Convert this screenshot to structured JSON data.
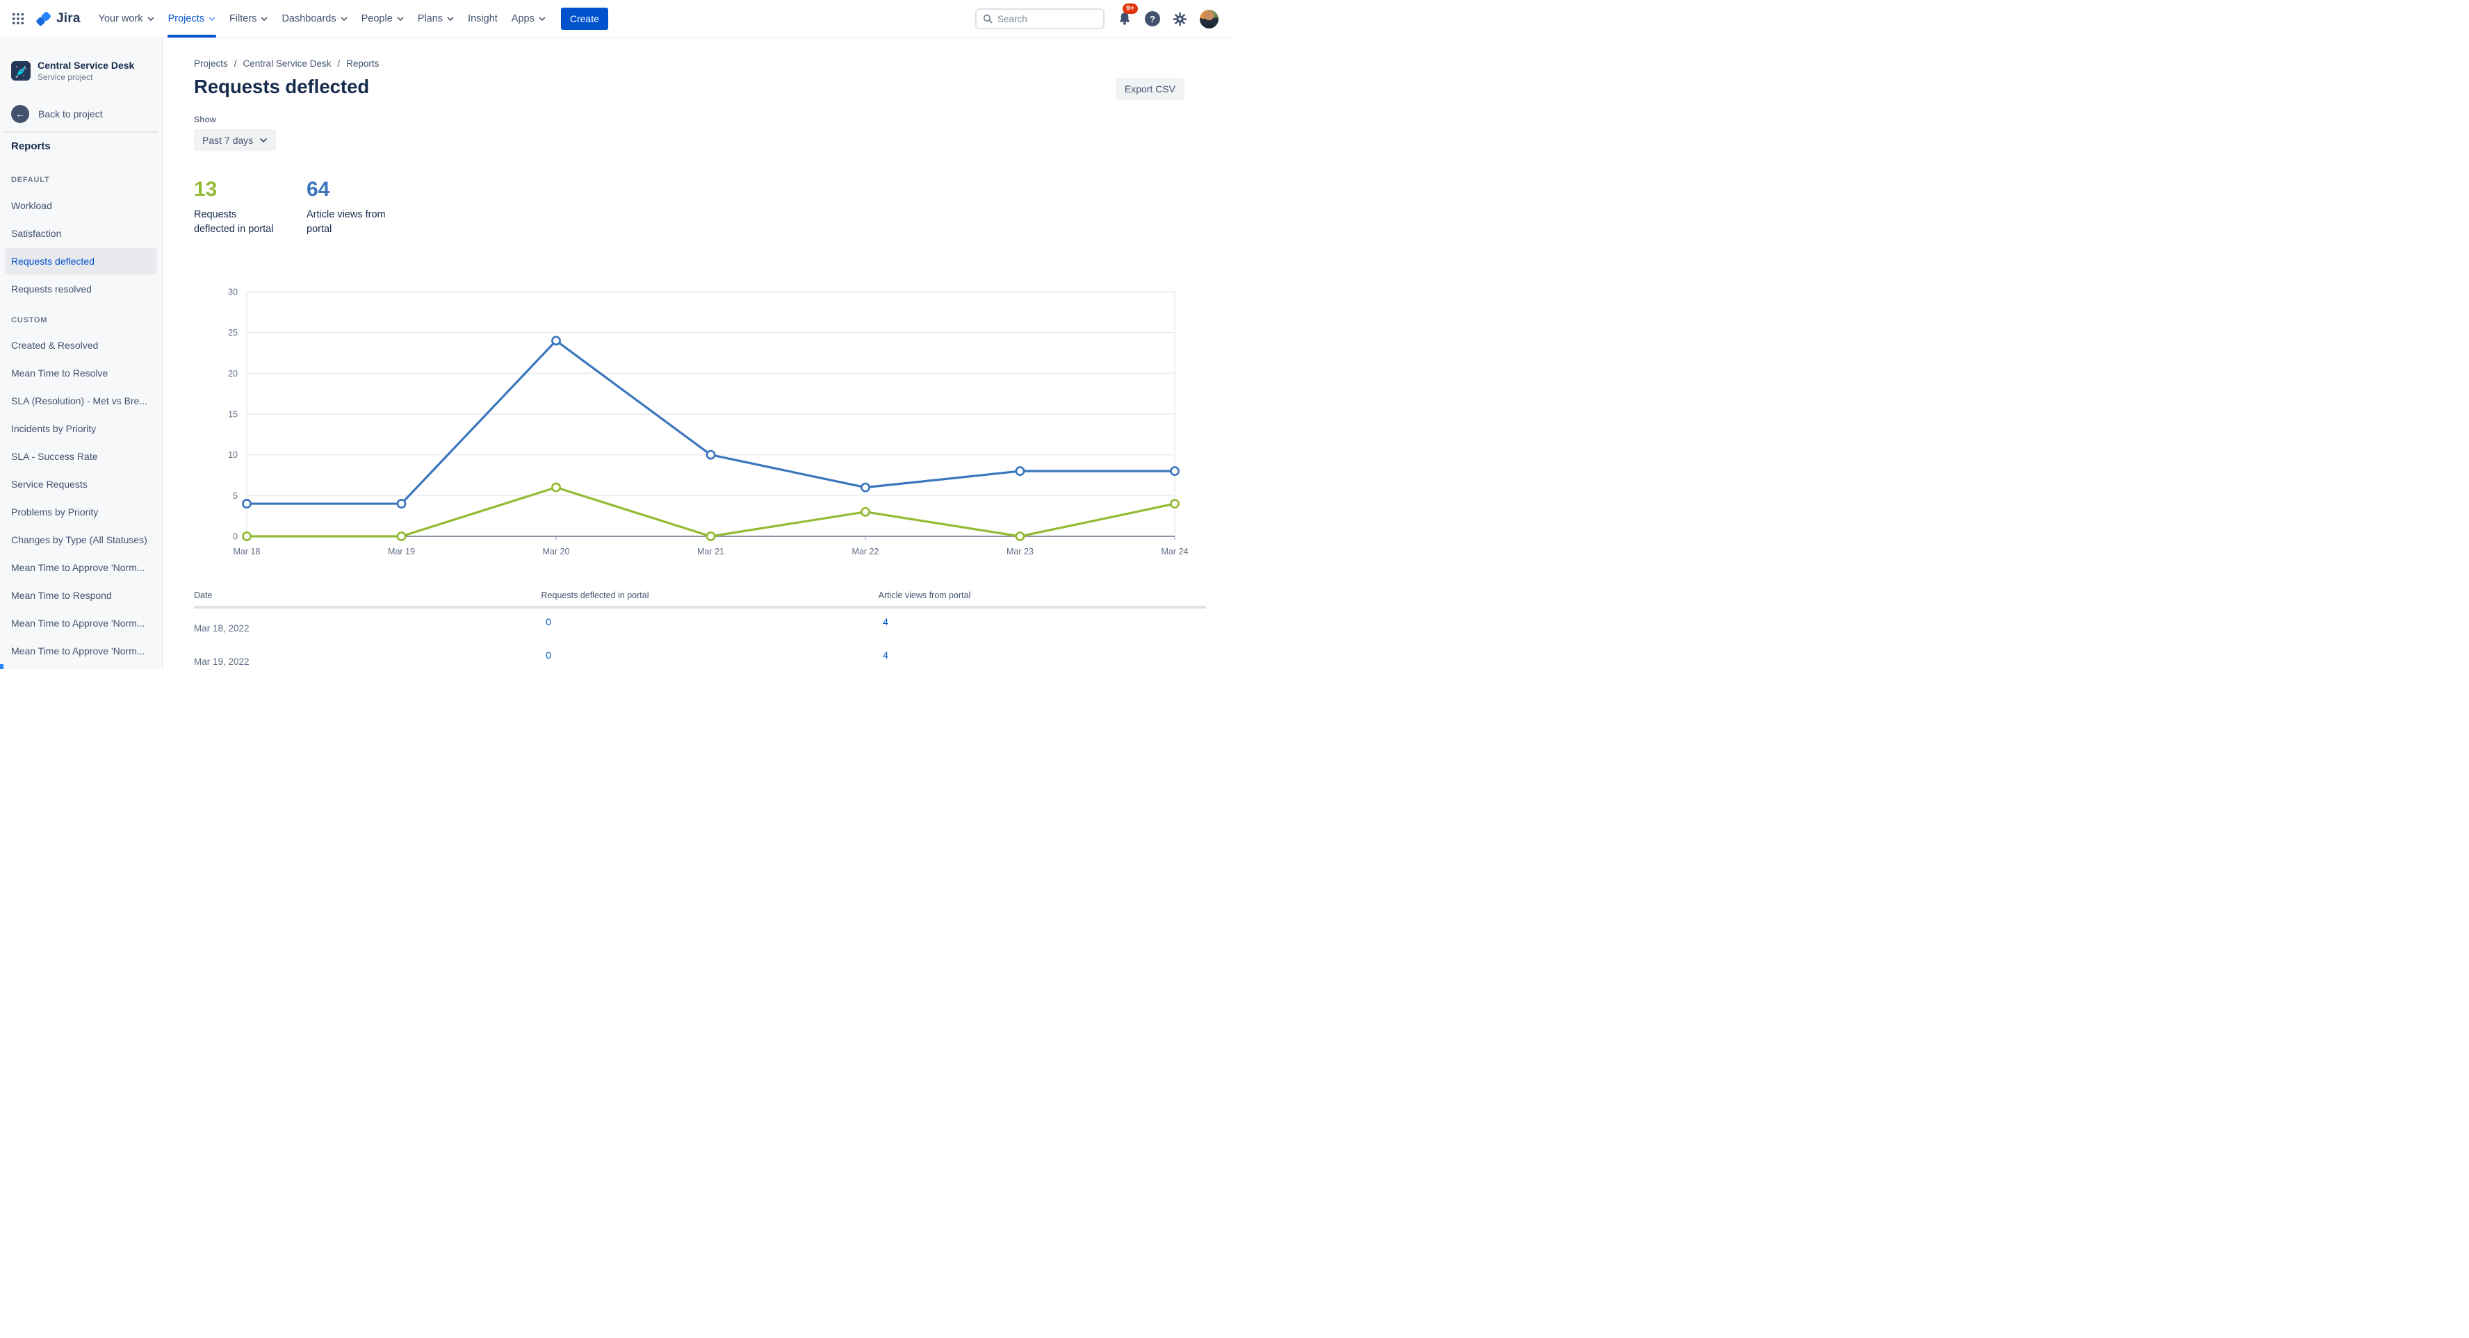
{
  "topnav": {
    "logo_text": "Jira",
    "items": [
      {
        "label": "Your work",
        "chevron": true,
        "active": false
      },
      {
        "label": "Projects",
        "chevron": true,
        "active": true
      },
      {
        "label": "Filters",
        "chevron": true,
        "active": false
      },
      {
        "label": "Dashboards",
        "chevron": true,
        "active": false
      },
      {
        "label": "People",
        "chevron": true,
        "active": false
      },
      {
        "label": "Plans",
        "chevron": true,
        "active": false
      },
      {
        "label": "Insight",
        "chevron": false,
        "active": false
      },
      {
        "label": "Apps",
        "chevron": true,
        "active": false
      }
    ],
    "create_label": "Create",
    "search_placeholder": "Search",
    "notifications_badge": "9+",
    "help_glyph": "?"
  },
  "sidebar": {
    "project_name": "Central Service Desk",
    "project_type": "Service project",
    "back_label": "Back to project",
    "back_arrow_glyph": "←",
    "heading": "Reports",
    "sections": [
      {
        "title": "DEFAULT",
        "items": [
          {
            "label": "Workload",
            "active": false
          },
          {
            "label": "Satisfaction",
            "active": false
          },
          {
            "label": "Requests deflected",
            "active": true
          },
          {
            "label": "Requests resolved",
            "active": false
          }
        ]
      },
      {
        "title": "CUSTOM",
        "items": [
          {
            "label": "Created & Resolved",
            "active": false
          },
          {
            "label": "Mean Time to Resolve",
            "active": false
          },
          {
            "label": "SLA (Resolution) - Met vs Bre...",
            "active": false
          },
          {
            "label": "Incidents by Priority",
            "active": false
          },
          {
            "label": "SLA - Success Rate",
            "active": false
          },
          {
            "label": "Service Requests",
            "active": false
          },
          {
            "label": "Problems by Priority",
            "active": false
          },
          {
            "label": "Changes by Type (All Statuses)",
            "active": false
          },
          {
            "label": "Mean Time to Approve 'Norm...",
            "active": false
          },
          {
            "label": "Mean Time to Respond",
            "active": false
          },
          {
            "label": "Mean Time to Approve 'Norm...",
            "active": false
          },
          {
            "label": "Mean Time to Approve 'Norm...",
            "active": false
          }
        ]
      }
    ]
  },
  "main": {
    "breadcrumb": [
      "Projects",
      "Central Service Desk",
      "Reports"
    ],
    "breadcrumb_sep": "/",
    "title": "Requests deflected",
    "export_label": "Export CSV",
    "show_label": "Show",
    "range_value": "Past 7 days",
    "stats": [
      {
        "value": "13",
        "color": "#94ba33",
        "label_lines": [
          "Requests",
          "deflected in portal"
        ]
      },
      {
        "value": "64",
        "color": "#3b76bd",
        "label_lines": [
          "Article views from",
          "portal"
        ]
      }
    ]
  },
  "chart_data": {
    "type": "line",
    "x": [
      "Mar 18",
      "Mar 19",
      "Mar 20",
      "Mar 21",
      "Mar 22",
      "Mar 23",
      "Mar 24"
    ],
    "series": [
      {
        "name": "Article views from portal",
        "color": "#3b76bd",
        "values": [
          4,
          4,
          24,
          10,
          6,
          8,
          8
        ]
      },
      {
        "name": "Requests deflected in portal",
        "color": "#94ba33",
        "values": [
          0,
          0,
          6,
          0,
          3,
          0,
          4
        ]
      }
    ],
    "ylim": [
      0,
      30
    ],
    "yticks": [
      0,
      5,
      10,
      15,
      20,
      25,
      30
    ],
    "grid": true,
    "legend": "none",
    "grid_color": "#EBECF0",
    "axis_color": "#8993A4",
    "tick_label_color": "#5E6C84"
  },
  "table": {
    "columns": [
      "Date",
      "Requests deflected in portal",
      "Article views from portal"
    ],
    "rows": [
      {
        "date": "Mar 18, 2022",
        "deflected": "0",
        "views": "4"
      },
      {
        "date": "Mar 19, 2022",
        "deflected": "0",
        "views": "4"
      }
    ]
  }
}
